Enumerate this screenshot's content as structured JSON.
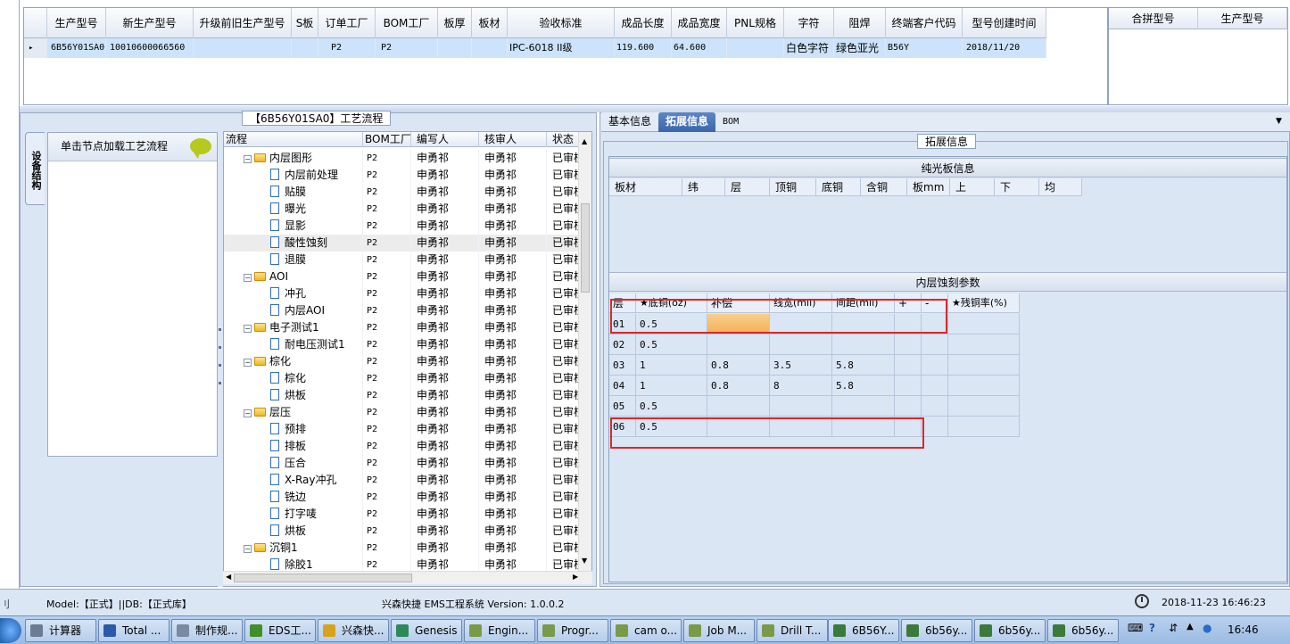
{
  "top_grid": {
    "columns": [
      "生产型号",
      "新生产型号",
      "升级前旧生产型号",
      "S板",
      "订单工厂",
      "BOM工厂",
      "板厚",
      "板材",
      "验收标准",
      "成品长度",
      "成品宽度",
      "PNL规格",
      "字符",
      "阻焊",
      "终端客户代码",
      "型号创建时间"
    ],
    "row": {
      "marker": "▸",
      "cells": [
        "6B56Y01SA0",
        "10010600066560",
        "",
        "",
        "P2",
        "P2",
        "",
        "",
        "IPC-6018 II级",
        "119.600",
        "64.600",
        "",
        "白色字符",
        "绿色亚光",
        "B56Y",
        "2018/11/20"
      ]
    }
  },
  "side_grid": {
    "columns": [
      "合拼型号",
      "生产型号"
    ]
  },
  "process_panel": {
    "title": "【6B56Y01SA0】工艺流程",
    "vertical_tab": "设备结构",
    "load_hint": "单击节点加载工艺流程",
    "tree_columns": [
      "流程",
      "BOM工厂",
      "编写人",
      "核审人",
      "状态"
    ],
    "rows": [
      {
        "label": "内层图形",
        "kind": "folder",
        "bom": "P2",
        "author": "申勇祁",
        "reviewer": "申勇祁",
        "status": "已审核"
      },
      {
        "label": "内层前处理",
        "kind": "doc",
        "bom": "P2",
        "author": "申勇祁",
        "reviewer": "申勇祁",
        "status": "已审核"
      },
      {
        "label": "贴膜",
        "kind": "doc",
        "bom": "P2",
        "author": "申勇祁",
        "reviewer": "申勇祁",
        "status": "已审核"
      },
      {
        "label": "曝光",
        "kind": "doc",
        "bom": "P2",
        "author": "申勇祁",
        "reviewer": "申勇祁",
        "status": "已审核"
      },
      {
        "label": "显影",
        "kind": "doc",
        "bom": "P2",
        "author": "申勇祁",
        "reviewer": "申勇祁",
        "status": "已审核"
      },
      {
        "label": "酸性蚀刻",
        "kind": "doc",
        "bom": "P2",
        "author": "申勇祁",
        "reviewer": "申勇祁",
        "status": "已审核",
        "selected": true
      },
      {
        "label": "退膜",
        "kind": "doc",
        "bom": "P2",
        "author": "申勇祁",
        "reviewer": "申勇祁",
        "status": "已审核"
      },
      {
        "label": "AOI",
        "kind": "folder",
        "bom": "P2",
        "author": "申勇祁",
        "reviewer": "申勇祁",
        "status": "已审核"
      },
      {
        "label": "冲孔",
        "kind": "doc",
        "bom": "P2",
        "author": "申勇祁",
        "reviewer": "申勇祁",
        "status": "已审核"
      },
      {
        "label": "内层AOI",
        "kind": "doc",
        "bom": "P2",
        "author": "申勇祁",
        "reviewer": "申勇祁",
        "status": "已审核"
      },
      {
        "label": "电子测试1",
        "kind": "folder",
        "bom": "P2",
        "author": "申勇祁",
        "reviewer": "申勇祁",
        "status": "已审核"
      },
      {
        "label": "耐电压测试1",
        "kind": "doc",
        "bom": "P2",
        "author": "申勇祁",
        "reviewer": "申勇祁",
        "status": "已审核"
      },
      {
        "label": "棕化",
        "kind": "folder",
        "bom": "P2",
        "author": "申勇祁",
        "reviewer": "申勇祁",
        "status": "已审核"
      },
      {
        "label": "棕化",
        "kind": "doc",
        "bom": "P2",
        "author": "申勇祁",
        "reviewer": "申勇祁",
        "status": "已审核"
      },
      {
        "label": "烘板",
        "kind": "doc",
        "bom": "P2",
        "author": "申勇祁",
        "reviewer": "申勇祁",
        "status": "已审核"
      },
      {
        "label": "层压",
        "kind": "folder",
        "bom": "P2",
        "author": "申勇祁",
        "reviewer": "申勇祁",
        "status": "已审核"
      },
      {
        "label": "预排",
        "kind": "doc",
        "bom": "P2",
        "author": "申勇祁",
        "reviewer": "申勇祁",
        "status": "已审核"
      },
      {
        "label": "排板",
        "kind": "doc",
        "bom": "P2",
        "author": "申勇祁",
        "reviewer": "申勇祁",
        "status": "已审核"
      },
      {
        "label": "压合",
        "kind": "doc",
        "bom": "P2",
        "author": "申勇祁",
        "reviewer": "申勇祁",
        "status": "已审核"
      },
      {
        "label": "X-Ray冲孔",
        "kind": "doc",
        "bom": "P2",
        "author": "申勇祁",
        "reviewer": "申勇祁",
        "status": "已审核"
      },
      {
        "label": "铣边",
        "kind": "doc",
        "bom": "P2",
        "author": "申勇祁",
        "reviewer": "申勇祁",
        "status": "已审核"
      },
      {
        "label": "打字唛",
        "kind": "doc",
        "bom": "P2",
        "author": "申勇祁",
        "reviewer": "申勇祁",
        "status": "已审核"
      },
      {
        "label": "烘板",
        "kind": "doc",
        "bom": "P2",
        "author": "申勇祁",
        "reviewer": "申勇祁",
        "status": "已审核"
      },
      {
        "label": "沉铜1",
        "kind": "folder",
        "bom": "P2",
        "author": "申勇祁",
        "reviewer": "申勇祁",
        "status": "已审核"
      },
      {
        "label": "除胶1",
        "kind": "doc",
        "bom": "P2",
        "author": "申勇祁",
        "reviewer": "申勇祁",
        "status": "已审核"
      }
    ]
  },
  "right_tabs": [
    "基本信息",
    "拓展信息",
    "BOM"
  ],
  "right_tab_active": 1,
  "extended": {
    "group_title": "拓展信息",
    "section1_title": "纯光板信息",
    "section1_columns": [
      "板材",
      "纬",
      "层",
      "顶铜",
      "底铜",
      "含铜",
      "板mm",
      "上",
      "下",
      "均"
    ],
    "section2_title": "内层蚀刻参数",
    "section2_columns": [
      "层",
      "★底铜(oz)",
      "补偿",
      "线宽(mil)",
      "间距(mil)",
      "+",
      "-",
      "★残铜率(%)"
    ],
    "section2_rows": [
      [
        "01",
        "0.5",
        "",
        "",
        "",
        "",
        "",
        ""
      ],
      [
        "02",
        "0.5",
        "",
        "",
        "",
        "",
        "",
        ""
      ],
      [
        "03",
        "1",
        "0.8",
        "3.5",
        "5.8",
        "",
        "",
        ""
      ],
      [
        "04",
        "1",
        "0.8",
        "8",
        "5.8",
        "",
        "",
        ""
      ],
      [
        "05",
        "0.5",
        "",
        "",
        "",
        "",
        "",
        ""
      ],
      [
        "06",
        "0.5",
        "",
        "",
        "",
        "",
        "",
        ""
      ]
    ]
  },
  "status_bar": {
    "left": "Model:【正式】||DB:【正式库】",
    "center": "兴森快捷 EMS工程系统 Version: 1.0.0.2",
    "datetime": "2018-11-23 16:46:23"
  },
  "taskbar": {
    "items": [
      "计算器",
      "Total ...",
      "制作规...",
      "EDS工...",
      "兴森快...",
      "Genesis",
      "Engin...",
      "Progr...",
      "cam o...",
      "Job M...",
      "Drill T...",
      "6B56Y...",
      "6b56y...",
      "6b56y...",
      "6b56y..."
    ],
    "time": "16:46"
  },
  "colors": {
    "panel_bg": "#dbe6f5",
    "selected_row": "#cde3fb",
    "active_tab": "#3b66ac",
    "highlight_cell": "#f6b055",
    "annotation_box": "#d52b2b"
  }
}
